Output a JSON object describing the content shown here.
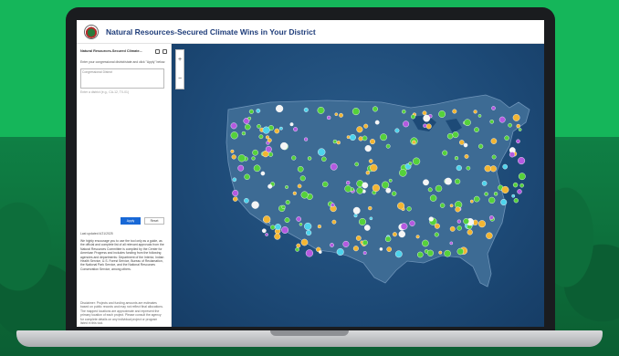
{
  "header": {
    "title": "Natural Resources-Secured Climate Wins in Your District",
    "logo_icon": "agency-seal-icon"
  },
  "panel": {
    "title": "Natural Resources-Secured Climate...",
    "instructions": "Enter your congressional district/state and click \"Apply\" below.",
    "input_placeholder": "Congressional District",
    "input_hint": "Enter a district (e.g., CA-12, TX-01)",
    "apply_label": "Apply",
    "reset_label": "Reset",
    "updated": "Last updated 4/21/2025",
    "paragraph_1": "We highly encourage you to use the tool only as a guide, as the official and complete list of all relevant approvals from the Natural Resources Committee is compiled by the Center for American Progress and includes funding from the following agencies and departments: Department of the Interior, Indian Health Service, U.S. Forest Service, Bureau of Reclamation, the National Park Service, and the National Resources Conservation Service, among others.",
    "paragraph_2": "Disclaimer: Projects and funding amounts are estimates based on public records and may not reflect final allocations. The mapped locations are approximate and represent the primary location of each project. Please consult the agency for complete details on any individual project or program listed in this tool."
  },
  "map": {
    "zoom_in": "+",
    "zoom_out": "−",
    "collapse": "‹",
    "background_color": "#1d4a77",
    "land_color": "#3d6b94",
    "marker_colors": {
      "green": "#55d13b",
      "yellow": "#f2b533",
      "purple": "#b45ae0",
      "cyan": "#4ed3ec",
      "white": "#f5f5f5"
    }
  }
}
